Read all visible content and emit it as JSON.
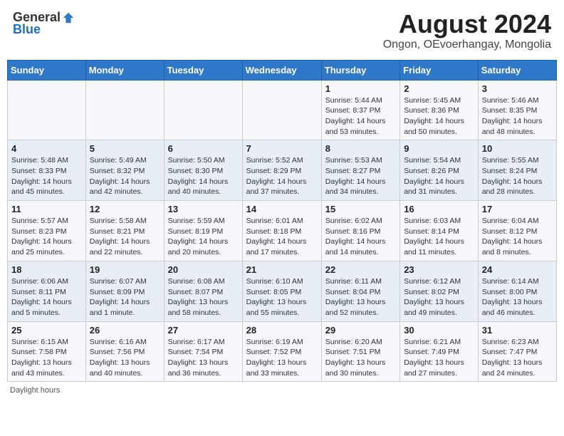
{
  "header": {
    "logo_general": "General",
    "logo_blue": "Blue",
    "main_title": "August 2024",
    "subtitle": "Ongon, OEvoerhangay, Mongolia"
  },
  "calendar": {
    "days_of_week": [
      "Sunday",
      "Monday",
      "Tuesday",
      "Wednesday",
      "Thursday",
      "Friday",
      "Saturday"
    ],
    "weeks": [
      [
        {
          "day": "",
          "info": ""
        },
        {
          "day": "",
          "info": ""
        },
        {
          "day": "",
          "info": ""
        },
        {
          "day": "",
          "info": ""
        },
        {
          "day": "1",
          "info": "Sunrise: 5:44 AM\nSunset: 8:37 PM\nDaylight: 14 hours\nand 53 minutes."
        },
        {
          "day": "2",
          "info": "Sunrise: 5:45 AM\nSunset: 8:36 PM\nDaylight: 14 hours\nand 50 minutes."
        },
        {
          "day": "3",
          "info": "Sunrise: 5:46 AM\nSunset: 8:35 PM\nDaylight: 14 hours\nand 48 minutes."
        }
      ],
      [
        {
          "day": "4",
          "info": "Sunrise: 5:48 AM\nSunset: 8:33 PM\nDaylight: 14 hours\nand 45 minutes."
        },
        {
          "day": "5",
          "info": "Sunrise: 5:49 AM\nSunset: 8:32 PM\nDaylight: 14 hours\nand 42 minutes."
        },
        {
          "day": "6",
          "info": "Sunrise: 5:50 AM\nSunset: 8:30 PM\nDaylight: 14 hours\nand 40 minutes."
        },
        {
          "day": "7",
          "info": "Sunrise: 5:52 AM\nSunset: 8:29 PM\nDaylight: 14 hours\nand 37 minutes."
        },
        {
          "day": "8",
          "info": "Sunrise: 5:53 AM\nSunset: 8:27 PM\nDaylight: 14 hours\nand 34 minutes."
        },
        {
          "day": "9",
          "info": "Sunrise: 5:54 AM\nSunset: 8:26 PM\nDaylight: 14 hours\nand 31 minutes."
        },
        {
          "day": "10",
          "info": "Sunrise: 5:55 AM\nSunset: 8:24 PM\nDaylight: 14 hours\nand 28 minutes."
        }
      ],
      [
        {
          "day": "11",
          "info": "Sunrise: 5:57 AM\nSunset: 8:23 PM\nDaylight: 14 hours\nand 25 minutes."
        },
        {
          "day": "12",
          "info": "Sunrise: 5:58 AM\nSunset: 8:21 PM\nDaylight: 14 hours\nand 22 minutes."
        },
        {
          "day": "13",
          "info": "Sunrise: 5:59 AM\nSunset: 8:19 PM\nDaylight: 14 hours\nand 20 minutes."
        },
        {
          "day": "14",
          "info": "Sunrise: 6:01 AM\nSunset: 8:18 PM\nDaylight: 14 hours\nand 17 minutes."
        },
        {
          "day": "15",
          "info": "Sunrise: 6:02 AM\nSunset: 8:16 PM\nDaylight: 14 hours\nand 14 minutes."
        },
        {
          "day": "16",
          "info": "Sunrise: 6:03 AM\nSunset: 8:14 PM\nDaylight: 14 hours\nand 11 minutes."
        },
        {
          "day": "17",
          "info": "Sunrise: 6:04 AM\nSunset: 8:12 PM\nDaylight: 14 hours\nand 8 minutes."
        }
      ],
      [
        {
          "day": "18",
          "info": "Sunrise: 6:06 AM\nSunset: 8:11 PM\nDaylight: 14 hours\nand 5 minutes."
        },
        {
          "day": "19",
          "info": "Sunrise: 6:07 AM\nSunset: 8:09 PM\nDaylight: 14 hours\nand 1 minute."
        },
        {
          "day": "20",
          "info": "Sunrise: 6:08 AM\nSunset: 8:07 PM\nDaylight: 13 hours\nand 58 minutes."
        },
        {
          "day": "21",
          "info": "Sunrise: 6:10 AM\nSunset: 8:05 PM\nDaylight: 13 hours\nand 55 minutes."
        },
        {
          "day": "22",
          "info": "Sunrise: 6:11 AM\nSunset: 8:04 PM\nDaylight: 13 hours\nand 52 minutes."
        },
        {
          "day": "23",
          "info": "Sunrise: 6:12 AM\nSunset: 8:02 PM\nDaylight: 13 hours\nand 49 minutes."
        },
        {
          "day": "24",
          "info": "Sunrise: 6:14 AM\nSunset: 8:00 PM\nDaylight: 13 hours\nand 46 minutes."
        }
      ],
      [
        {
          "day": "25",
          "info": "Sunrise: 6:15 AM\nSunset: 7:58 PM\nDaylight: 13 hours\nand 43 minutes."
        },
        {
          "day": "26",
          "info": "Sunrise: 6:16 AM\nSunset: 7:56 PM\nDaylight: 13 hours\nand 40 minutes."
        },
        {
          "day": "27",
          "info": "Sunrise: 6:17 AM\nSunset: 7:54 PM\nDaylight: 13 hours\nand 36 minutes."
        },
        {
          "day": "28",
          "info": "Sunrise: 6:19 AM\nSunset: 7:52 PM\nDaylight: 13 hours\nand 33 minutes."
        },
        {
          "day": "29",
          "info": "Sunrise: 6:20 AM\nSunset: 7:51 PM\nDaylight: 13 hours\nand 30 minutes."
        },
        {
          "day": "30",
          "info": "Sunrise: 6:21 AM\nSunset: 7:49 PM\nDaylight: 13 hours\nand 27 minutes."
        },
        {
          "day": "31",
          "info": "Sunrise: 6:23 AM\nSunset: 7:47 PM\nDaylight: 13 hours\nand 24 minutes."
        }
      ]
    ]
  },
  "footer": {
    "note": "Daylight hours"
  }
}
